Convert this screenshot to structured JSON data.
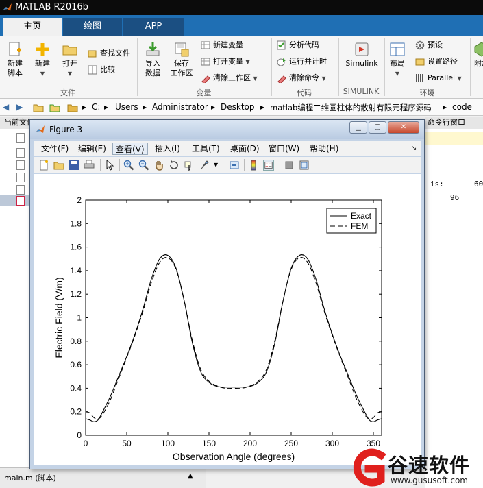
{
  "app": {
    "title": "MATLAB R2016b"
  },
  "tabs": [
    "主页",
    "绘图",
    "APP"
  ],
  "ribbon": {
    "file": {
      "new_script": "新建\n脚本",
      "new": "新建",
      "open": "打开",
      "find_files": "查找文件",
      "compare": "比较",
      "label": "文件"
    },
    "variable": {
      "import_data": "导入\n数据",
      "save_workspace": "保存\n工作区",
      "new_variable": "新建变量",
      "open_variable": "打开变量",
      "clear_workspace": "清除工作区",
      "label": "变量"
    },
    "code": {
      "analyze_code": "分析代码",
      "run_and_time": "运行并计时",
      "clear_commands": "清除命令",
      "label": "代码"
    },
    "simulink": {
      "button": "Simulink",
      "label": "SIMULINK"
    },
    "environment": {
      "layout": "布局",
      "preferences": "预设",
      "set_path": "设置路径",
      "parallel": "Parallel",
      "addons": "附加",
      "label": "环境"
    }
  },
  "address": {
    "crumbs": [
      "C:",
      "Users",
      "Administrator",
      "Desktop",
      "matlab编程二维圆柱体的散射有限元程序源码",
      "code"
    ]
  },
  "left_panel": {
    "header": "当前文件夹",
    "footer": "main.m  (脚本)"
  },
  "command_window": {
    "header": "命令行窗口",
    "line1_label": "ry is:",
    "line1_value": "60",
    "line2_value": "96"
  },
  "figure": {
    "title": "Figure 3",
    "window_buttons": [
      "▁",
      "▢",
      "✕"
    ],
    "menu": [
      "文件(F)",
      "编辑(E)",
      "查看(V)",
      "插入(I)",
      "工具(T)",
      "桌面(D)",
      "窗口(W)",
      "帮助(H)"
    ]
  },
  "chart_data": {
    "type": "line",
    "title": "",
    "xlabel": "Observation Angle (degrees)",
    "ylabel": "Electric Field (V/m)",
    "xlim": [
      0,
      360
    ],
    "ylim": [
      0,
      2
    ],
    "xticks": [
      0,
      50,
      100,
      150,
      200,
      250,
      300,
      350
    ],
    "yticks": [
      0,
      0.2,
      0.4,
      0.6,
      0.8,
      1,
      1.2,
      1.4,
      1.6,
      1.8,
      2
    ],
    "grid": false,
    "legend": {
      "position": "top-right",
      "entries": [
        "Exact",
        "FEM"
      ]
    },
    "series": [
      {
        "name": "Exact",
        "style": "solid",
        "x": [
          0,
          5,
          10,
          15,
          20,
          30,
          40,
          50,
          60,
          70,
          80,
          90,
          100,
          110,
          120,
          130,
          140,
          150,
          160,
          170,
          180,
          190,
          200,
          210,
          220,
          230,
          240,
          250,
          260,
          270,
          280,
          290,
          300,
          310,
          320,
          330,
          340,
          345,
          350,
          355,
          360
        ],
        "y": [
          0.14,
          0.13,
          0.115,
          0.13,
          0.19,
          0.33,
          0.5,
          0.67,
          0.86,
          1.08,
          1.33,
          1.5,
          1.53,
          1.42,
          1.14,
          0.78,
          0.54,
          0.45,
          0.415,
          0.41,
          0.41,
          0.41,
          0.415,
          0.45,
          0.54,
          0.78,
          1.14,
          1.42,
          1.53,
          1.5,
          1.33,
          1.08,
          0.86,
          0.67,
          0.5,
          0.33,
          0.19,
          0.13,
          0.115,
          0.13,
          0.14
        ]
      },
      {
        "name": "FEM",
        "style": "dashed",
        "x": [
          0,
          5,
          10,
          15,
          20,
          30,
          40,
          50,
          60,
          70,
          80,
          90,
          100,
          110,
          120,
          130,
          140,
          150,
          160,
          170,
          180,
          190,
          200,
          210,
          220,
          230,
          240,
          250,
          260,
          270,
          280,
          290,
          300,
          310,
          320,
          330,
          340,
          345,
          350,
          355,
          360
        ],
        "y": [
          0.2,
          0.19,
          0.15,
          0.14,
          0.17,
          0.3,
          0.48,
          0.66,
          0.85,
          1.06,
          1.3,
          1.47,
          1.51,
          1.41,
          1.14,
          0.8,
          0.56,
          0.46,
          0.42,
          0.4,
          0.4,
          0.4,
          0.42,
          0.46,
          0.56,
          0.8,
          1.14,
          1.41,
          1.51,
          1.47,
          1.3,
          1.06,
          0.85,
          0.66,
          0.48,
          0.3,
          0.17,
          0.14,
          0.15,
          0.19,
          0.2
        ]
      }
    ]
  },
  "watermark": {
    "text": "谷速软件",
    "url": "www.gususoft.com",
    "brand_color": "#e0201d"
  }
}
